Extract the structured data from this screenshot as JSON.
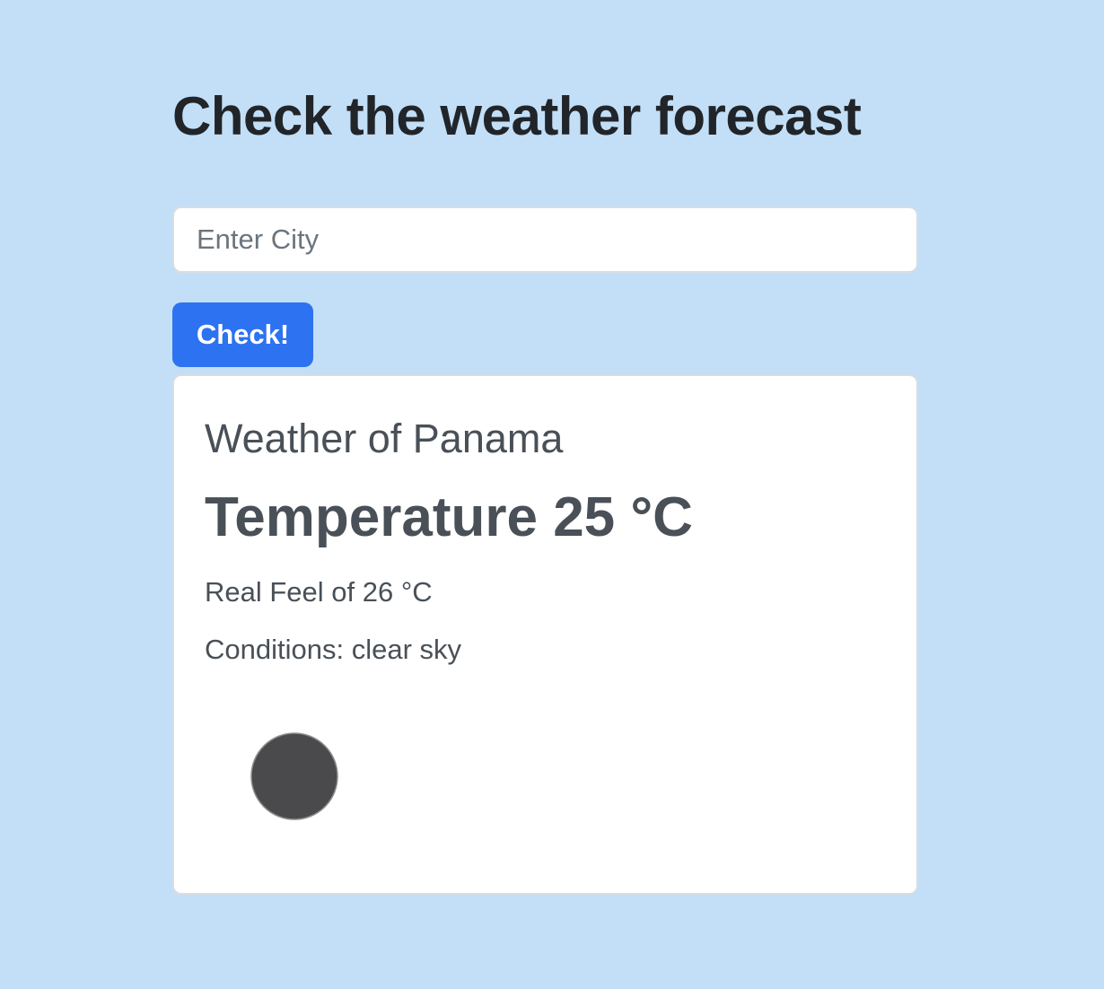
{
  "header": {
    "title": "Check the weather forecast"
  },
  "search": {
    "placeholder": "Enter City",
    "value": "",
    "button_label": "Check!"
  },
  "weather": {
    "title": "Weather of Panama",
    "temperature": "Temperature 25 °C",
    "real_feel": "Real Feel of 26 °C",
    "conditions": "Conditions: clear sky",
    "icon": "clear-sky-icon"
  },
  "colors": {
    "background": "#c2dff7",
    "accent": "#2d72f0",
    "icon": "#4a4a4c"
  }
}
